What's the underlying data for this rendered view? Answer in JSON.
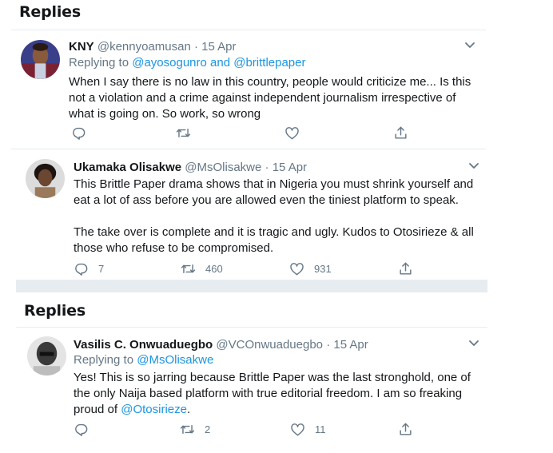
{
  "sections": [
    {
      "heading": "Replies",
      "tweets": [
        {
          "name": "KNY",
          "handle": "@kennyoamusan",
          "date": "15 Apr",
          "replying_prefix": "Replying to ",
          "replying_users": [
            "@ayosogunro",
            "and",
            "@brittlepaper"
          ],
          "body": "When I say  there is no law in this country, people would criticize me... Is this\nnot a violation and a crime against independent journalism irrespective of\nwhat is going on. So work, so wrong",
          "reply_count": "",
          "retweet_count": "",
          "like_count": ""
        },
        {
          "name": "Ukamaka Olisakwe",
          "handle": "@MsOlisakwe",
          "date": "15 Apr",
          "body": "This Brittle Paper drama shows that in Nigeria you must shrink yourself and\neat a lot of ass before you are allowed even the tiniest platform to speak.\n\nThe take over is complete and it is tragic and ugly. Kudos to Otosirieze & all\nthose who refuse to be compromised.",
          "reply_count": "7",
          "retweet_count": "460",
          "like_count": "931"
        }
      ]
    },
    {
      "heading": "Replies",
      "tweets": [
        {
          "name": "Vasilis C. Onwuaduegbo",
          "handle": "@VCOnwuaduegbo",
          "date": "15 Apr",
          "replying_prefix": "Replying to ",
          "replying_users": [
            "@MsOlisakwe"
          ],
          "body_parts": [
            "Yes! This is so jarring because Brittle Paper was the last stronghold, one of\nthe only Naija based platform with true editorial freedom. I am so freaking\nproud of ",
            "@Otosirieze",
            "."
          ],
          "reply_count": "",
          "retweet_count": "2",
          "like_count": "11"
        }
      ]
    }
  ],
  "dot": "·",
  "icons": {
    "reply": "reply-icon",
    "retweet": "retweet-icon",
    "like": "heart-icon",
    "share": "share-icon",
    "more": "chevron-down-icon"
  },
  "colors": {
    "text": "#14171a",
    "muted": "#657786",
    "link": "#1b95e0",
    "divider": "#e6ecf0"
  }
}
